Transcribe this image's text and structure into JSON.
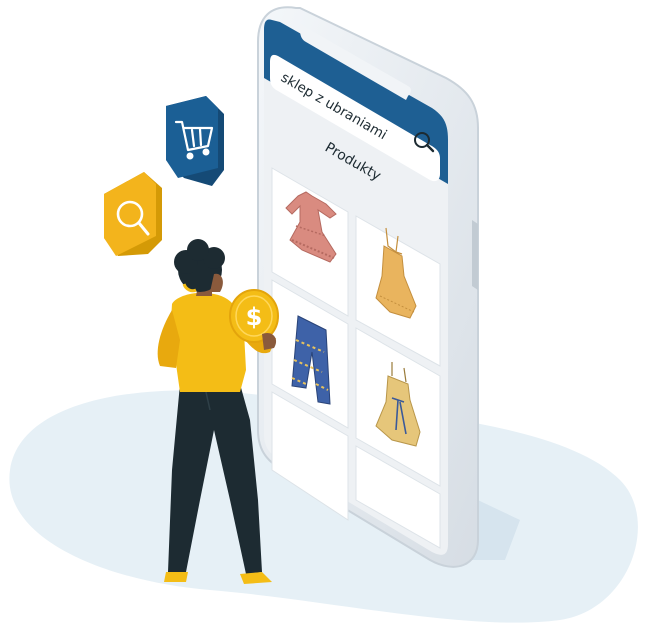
{
  "search": {
    "query": "sklep z ubraniami",
    "icon": "magnifier-icon"
  },
  "catalog": {
    "title": "Produkty",
    "products": [
      {
        "type": "dress-ruffled",
        "color": "#d98b80"
      },
      {
        "type": "dress-strappy",
        "color": "#e9b45e"
      },
      {
        "type": "trousers-patterned",
        "color": "#3e62a8"
      },
      {
        "type": "dress-bow",
        "color": "#e6c67a"
      }
    ]
  },
  "floating_icons": [
    {
      "name": "cart-icon",
      "color": "#1b5f95"
    },
    {
      "name": "search-icon",
      "color": "#f3b41c"
    }
  ],
  "coin_symbol": "$",
  "colors": {
    "brand_blue": "#1e5f93",
    "yellow": "#f4bd16",
    "dark": "#1d2b32",
    "screen": "#eef1f4"
  }
}
